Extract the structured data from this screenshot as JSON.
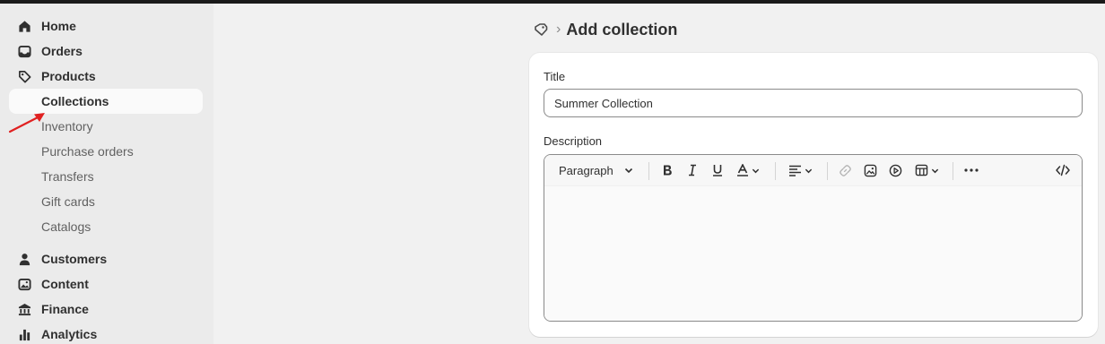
{
  "sidebar": {
    "items": [
      {
        "label": "Home",
        "icon": "home-icon"
      },
      {
        "label": "Orders",
        "icon": "inbox-icon"
      },
      {
        "label": "Products",
        "icon": "tag-icon"
      }
    ],
    "product_subitems": [
      {
        "label": "Collections",
        "active": true
      },
      {
        "label": "Inventory"
      },
      {
        "label": "Purchase orders"
      },
      {
        "label": "Transfers"
      },
      {
        "label": "Gift cards"
      },
      {
        "label": "Catalogs"
      }
    ],
    "more_items": [
      {
        "label": "Customers",
        "icon": "person-icon"
      },
      {
        "label": "Content",
        "icon": "image-icon"
      },
      {
        "label": "Finance",
        "icon": "bank-icon"
      },
      {
        "label": "Analytics",
        "icon": "bar-chart-icon"
      }
    ]
  },
  "header": {
    "breadcrumb_icon": "tag-icon",
    "separator": "›",
    "title": "Add collection"
  },
  "form": {
    "title_label": "Title",
    "title_value": "Summer Collection",
    "description_label": "Description",
    "toolbar": {
      "paragraph_label": "Paragraph",
      "tools": [
        "bold",
        "italic",
        "underline",
        "text-color",
        "align",
        "link",
        "image",
        "video",
        "table",
        "more",
        "code"
      ]
    }
  },
  "colors": {
    "sidebar_bg": "#ebebeb",
    "page_bg": "#f1f1f1",
    "annotation_arrow": "#e02020"
  }
}
